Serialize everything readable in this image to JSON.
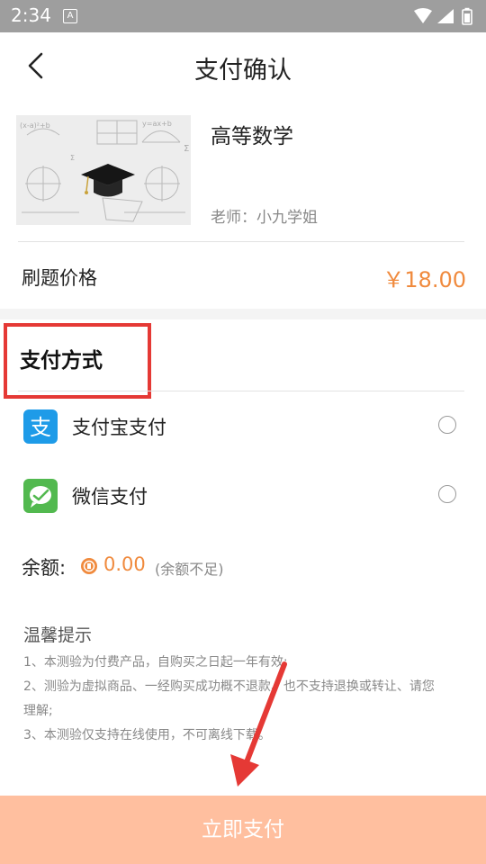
{
  "status_bar": {
    "time": "2:34",
    "indicator": "A"
  },
  "header": {
    "back_icon": "chevron-left-icon",
    "title": "支付确认"
  },
  "course": {
    "name": "高等数学",
    "teacher": "老师：小九学姐"
  },
  "price": {
    "label": "刷题价格",
    "value": "￥18.00"
  },
  "payment": {
    "heading": "支付方式",
    "methods": [
      {
        "label": "支付宝支付",
        "icon": "alipay-icon"
      },
      {
        "label": "微信支付",
        "icon": "wechat-icon"
      }
    ]
  },
  "balance": {
    "label": "余额:",
    "value": "0.00",
    "note": "(余额不足)"
  },
  "tips": {
    "title": "温馨提示",
    "lines": [
      "1、本测验为付费产品，自购买之日起一年有效;",
      "2、测验为虚拟商品、一经购买成功概不退款、也不支持退换或转让、请您",
      "理解;",
      "3、本测验仅支持在线使用，不可离线下载。"
    ]
  },
  "footer": {
    "button": "立即支付"
  },
  "colors": {
    "accent": "#f08a3d",
    "button_bg": "#ffbf9f",
    "annotation_red": "#e53935",
    "alipay_blue": "#1e9be8",
    "wechat_green": "#52b94f"
  }
}
